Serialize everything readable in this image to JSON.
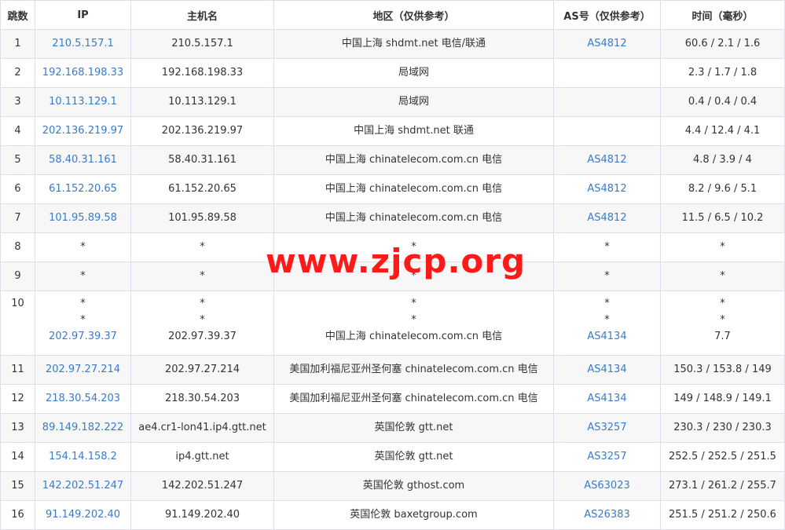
{
  "headers": {
    "hop": "跳数",
    "ip": "IP",
    "host": "主机名",
    "region": "地区（仅供参考）",
    "as": "AS号（仅供参考）",
    "time": "时间（毫秒）"
  },
  "colors": {
    "link": "#3a7bc8",
    "border": "#dcdfe6",
    "row_alt": "#f7f7f7",
    "watermark": "#ff1a1a"
  },
  "watermark": "www.zjcp.org",
  "rows": [
    {
      "hop": "1",
      "ip": "210.5.157.1",
      "host": "210.5.157.1",
      "region": "中国上海 shdmt.net 电信/联通",
      "as": "AS4812",
      "time": "60.6 / 2.1 / 1.6"
    },
    {
      "hop": "2",
      "ip": "192.168.198.33",
      "host": "192.168.198.33",
      "region": "局域网",
      "as": "",
      "time": "2.3 / 1.7 / 1.8"
    },
    {
      "hop": "3",
      "ip": "10.113.129.1",
      "host": "10.113.129.1",
      "region": "局域网",
      "as": "",
      "time": "0.4 / 0.4 / 0.4"
    },
    {
      "hop": "4",
      "ip": "202.136.219.97",
      "host": "202.136.219.97",
      "region": "中国上海 shdmt.net 联通",
      "as": "",
      "time": "4.4 / 12.4 / 4.1"
    },
    {
      "hop": "5",
      "ip": "58.40.31.161",
      "host": "58.40.31.161",
      "region": "中国上海 chinatelecom.com.cn 电信",
      "as": "AS4812",
      "time": "4.8 / 3.9 / 4"
    },
    {
      "hop": "6",
      "ip": "61.152.20.65",
      "host": "61.152.20.65",
      "region": "中国上海 chinatelecom.com.cn 电信",
      "as": "AS4812",
      "time": "8.2 / 9.6 / 5.1"
    },
    {
      "hop": "7",
      "ip": "101.95.89.58",
      "host": "101.95.89.58",
      "region": "中国上海 chinatelecom.com.cn 电信",
      "as": "AS4812",
      "time": "11.5 / 6.5 / 10.2"
    },
    {
      "hop": "8",
      "ip": "*",
      "host": "*",
      "region": "*",
      "as": "*",
      "time": "*"
    },
    {
      "hop": "9",
      "ip": "*",
      "host": "*",
      "region": "*",
      "as": "*",
      "time": "*"
    },
    {
      "hop": "10",
      "ip": [
        "*",
        "*",
        "202.97.39.37"
      ],
      "host": [
        "*",
        "*",
        "202.97.39.37"
      ],
      "region": [
        "*",
        "*",
        "中国上海 chinatelecom.com.cn 电信"
      ],
      "as": [
        "*",
        "*",
        "AS4134"
      ],
      "time": [
        "*",
        "*",
        "7.7"
      ]
    },
    {
      "hop": "11",
      "ip": "202.97.27.214",
      "host": "202.97.27.214",
      "region": "美国加利福尼亚州圣何塞 chinatelecom.com.cn 电信",
      "as": "AS4134",
      "time": "150.3 / 153.8 / 149"
    },
    {
      "hop": "12",
      "ip": "218.30.54.203",
      "host": "218.30.54.203",
      "region": "美国加利福尼亚州圣何塞 chinatelecom.com.cn 电信",
      "as": "AS4134",
      "time": "149 / 148.9 / 149.1"
    },
    {
      "hop": "13",
      "ip": "89.149.182.222",
      "host": "ae4.cr1-lon41.ip4.gtt.net",
      "region": "英国伦敦 gtt.net",
      "as": "AS3257",
      "time": "230.3 / 230 / 230.3"
    },
    {
      "hop": "14",
      "ip": "154.14.158.2",
      "host": "ip4.gtt.net",
      "region": "英国伦敦 gtt.net",
      "as": "AS3257",
      "time": "252.5 / 252.5 / 251.5"
    },
    {
      "hop": "15",
      "ip": "142.202.51.247",
      "host": "142.202.51.247",
      "region": "英国伦敦 gthost.com",
      "as": "AS63023",
      "time": "273.1 / 261.2 / 255.7"
    },
    {
      "hop": "16",
      "ip": "91.149.202.40",
      "host": "91.149.202.40",
      "region": "英国伦敦 baxetgroup.com",
      "as": "AS26383",
      "time": "251.5 / 251.2 / 250.6"
    }
  ]
}
